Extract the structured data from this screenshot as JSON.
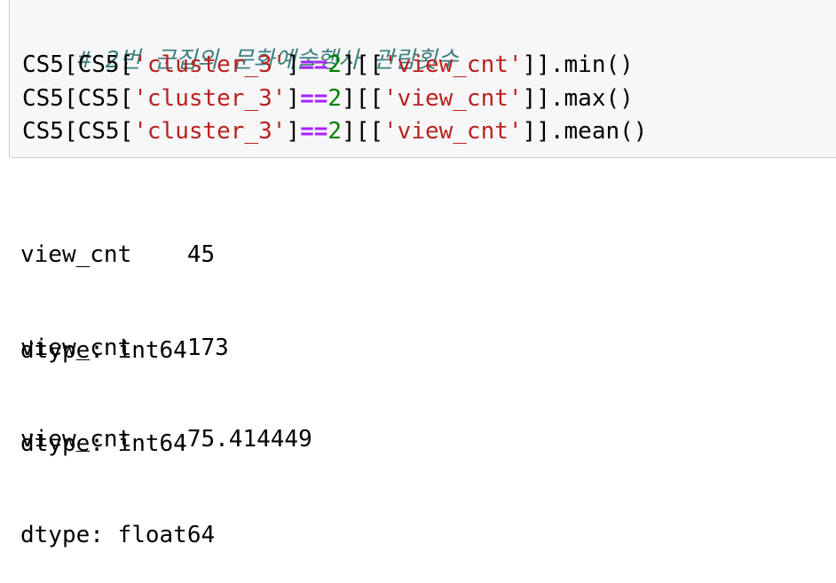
{
  "input_cell": {
    "comment": "# 2번 군집의 문화예술행사 관람횟수",
    "lines": [
      {
        "prefix": "CS5[CS5[",
        "string1": "'cluster_3'",
        "bracket_close": "]",
        "operator": "==",
        "number": "2",
        "mid": "][[",
        "string2": "'view_cnt'",
        "suffix": "]].min()"
      },
      {
        "prefix": "CS5[CS5[",
        "string1": "'cluster_3'",
        "bracket_close": "]",
        "operator": "==",
        "number": "2",
        "mid": "][[",
        "string2": "'view_cnt'",
        "suffix": "]].max()"
      },
      {
        "prefix": "CS5[CS5[",
        "string1": "'cluster_3'",
        "bracket_close": "]",
        "operator": "==",
        "number": "2",
        "mid": "][[",
        "string2": "'view_cnt'",
        "suffix": "]].mean()"
      }
    ]
  },
  "outputs": [
    {
      "line1": "view_cnt    45",
      "line2": "dtype: int64"
    },
    {
      "line1": "view_cnt    173",
      "line2": "dtype: int64"
    },
    {
      "line1": "view_cnt    75.414449",
      "line2": "dtype: float64"
    }
  ]
}
